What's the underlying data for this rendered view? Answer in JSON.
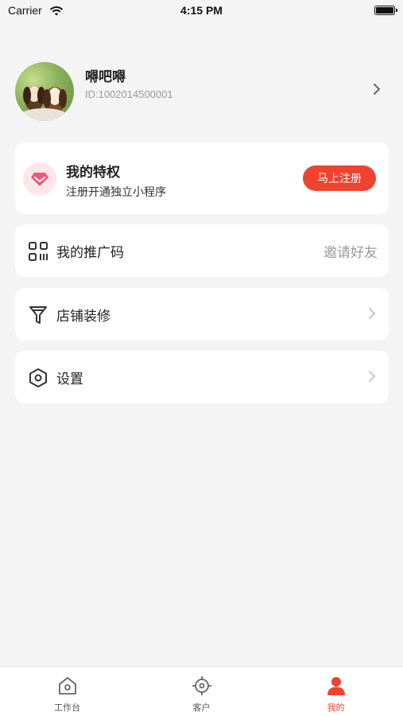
{
  "status_bar": {
    "carrier": "Carrier",
    "time": "4:15 PM"
  },
  "profile": {
    "nickname": "嘚吧嘚",
    "id_text": "ID:1002014500001"
  },
  "privilege": {
    "title": "我的特权",
    "subtitle": "注册开通独立小程序",
    "button": "马上注册"
  },
  "menu": [
    {
      "label": "我的推广码",
      "right_text": "邀请好友",
      "icon": "qr-code-icon"
    },
    {
      "label": "店铺装修",
      "icon": "funnel-icon"
    },
    {
      "label": "设置",
      "icon": "hexagon-settings-icon"
    }
  ],
  "tabs": [
    {
      "label": "工作台",
      "icon": "home-icon"
    },
    {
      "label": "客户",
      "icon": "crosshair-icon"
    },
    {
      "label": "我的",
      "icon": "user-icon",
      "active": true
    }
  ],
  "colors": {
    "accent": "#f0432f",
    "background": "#f4f4f5",
    "card": "#ffffff"
  }
}
